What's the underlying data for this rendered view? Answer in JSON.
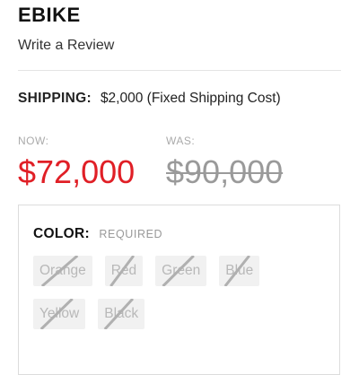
{
  "product": {
    "title": "EBIKE",
    "write_review": "Write a Review"
  },
  "shipping": {
    "label": "SHIPPING:",
    "value": "$2,000 (Fixed Shipping Cost)"
  },
  "pricing": {
    "now_label": "NOW:",
    "now_price": "$72,000",
    "was_label": "WAS:",
    "was_price": "$90,000"
  },
  "color_option": {
    "label": "COLOR:",
    "required_text": "REQUIRED",
    "options": [
      {
        "label": "Orange",
        "available": false
      },
      {
        "label": "Red",
        "available": false
      },
      {
        "label": "Green",
        "available": false
      },
      {
        "label": "Blue",
        "available": false
      },
      {
        "label": "Yellow",
        "available": false
      },
      {
        "label": "Black",
        "available": false
      }
    ]
  },
  "colors": {
    "sale_price": "#e01f26",
    "muted": "#9a9a9a"
  }
}
